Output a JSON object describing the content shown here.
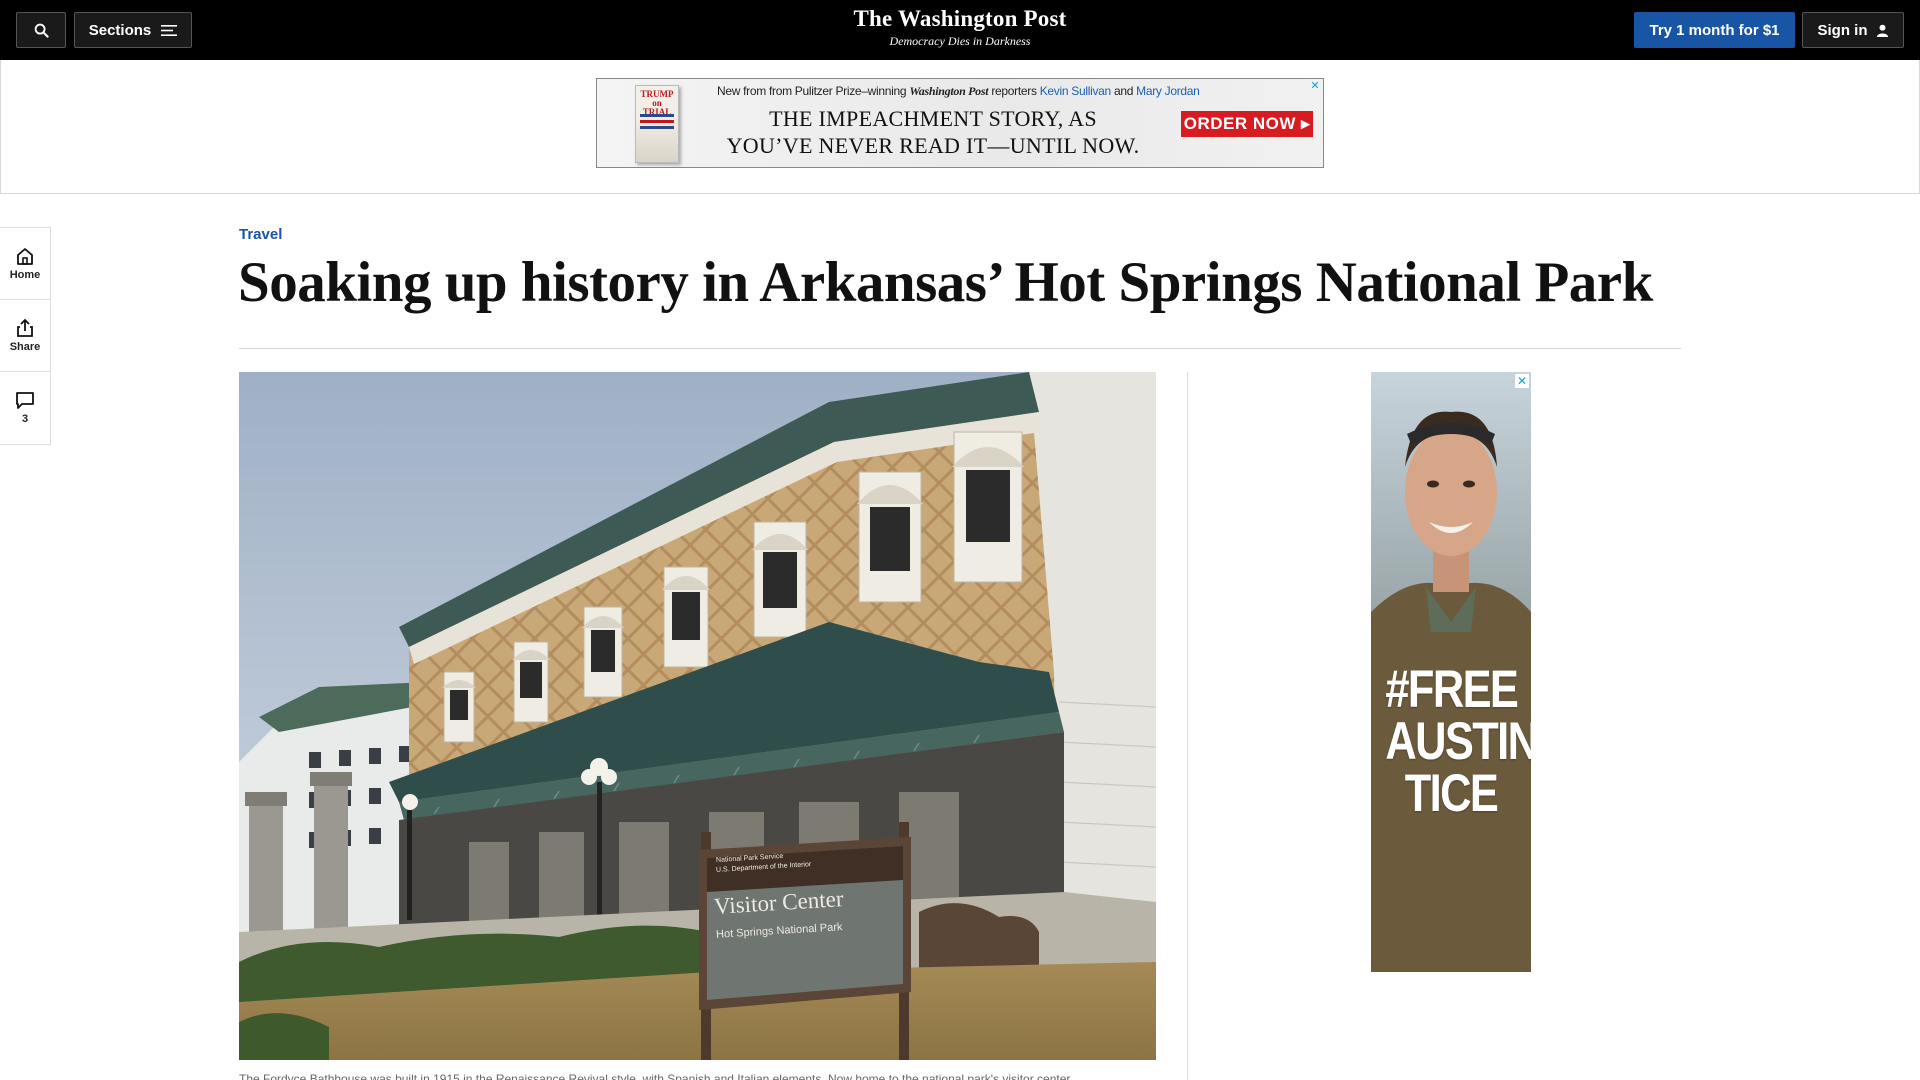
{
  "masthead": {
    "search_icon": "search-icon",
    "sections_label": "Sections",
    "sections_icon": "hamburger-menu-icon",
    "logo_name": "The Washington Post",
    "logo_tagline": "Democracy Dies in Darkness",
    "subscribe_label": "Try 1 month for $1",
    "signin_label": "Sign in",
    "signin_icon": "user-icon"
  },
  "banner_ad": {
    "book_title": "TRUMP on TRIAL",
    "topline_prefix": "New from from Pulitzer Prize–winning",
    "topline_pub": "Washington Post",
    "topline_mid": "reporters",
    "author1": "Kevin Sullivan",
    "and": "and",
    "author2": "Mary Jordan",
    "headline_line1": "THE IMPEACHMENT STORY, AS",
    "headline_line2": "YOU’VE NEVER READ IT—UNTIL NOW.",
    "cta": "ORDER NOW ▸",
    "close_icon": "adchoices-close-icon"
  },
  "left_rail": {
    "home_label": "Home",
    "share_label": "Share",
    "comments_count": "3"
  },
  "article": {
    "kicker": "Travel",
    "headline": "Soaking up history in Arkansas’ Hot Springs National Park",
    "photo_sign_agency": "National Park Service",
    "photo_sign_dept": "U.S. Department of the Interior",
    "photo_sign_title": "Visitor Center",
    "photo_sign_subtitle": "Hot Springs National Park",
    "caption": "The Fordyce Bathhouse was built in 1915 in the Renaissance Revival style, with Spanish and Italian elements. Now home to the national park's visitor center,"
  },
  "side_ad": {
    "text_line1": "#FREE",
    "text_line2": "AUSTIN",
    "text_line3": "TICE"
  },
  "colors": {
    "masthead_bg": "#000000",
    "accent_blue": "#1955a5",
    "ad_red": "#d81b21"
  }
}
